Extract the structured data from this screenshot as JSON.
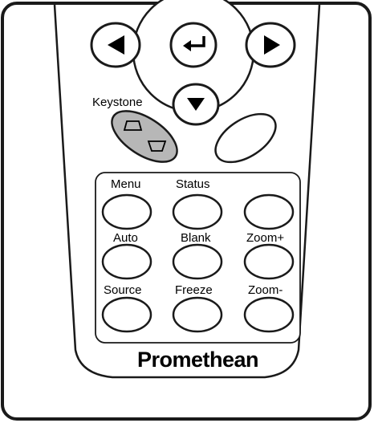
{
  "labels": {
    "keystone": "Keystone",
    "menu": "Menu",
    "status": "Status",
    "auto": "Auto",
    "blank": "Blank",
    "zoom_plus": "Zoom+",
    "source": "Source",
    "freeze": "Freeze",
    "zoom_minus": "Zoom-"
  },
  "brand": "Promethean",
  "colors": {
    "outline": "#1a1a1a",
    "keystone_fill": "#b7b7b7"
  },
  "icons": {
    "left": "left-arrow-icon",
    "enter": "enter-icon",
    "right": "right-arrow-icon",
    "down": "down-arrow-icon",
    "keystone_up": "keystone-trapezoid-up-icon",
    "keystone_down": "keystone-trapezoid-down-icon"
  }
}
